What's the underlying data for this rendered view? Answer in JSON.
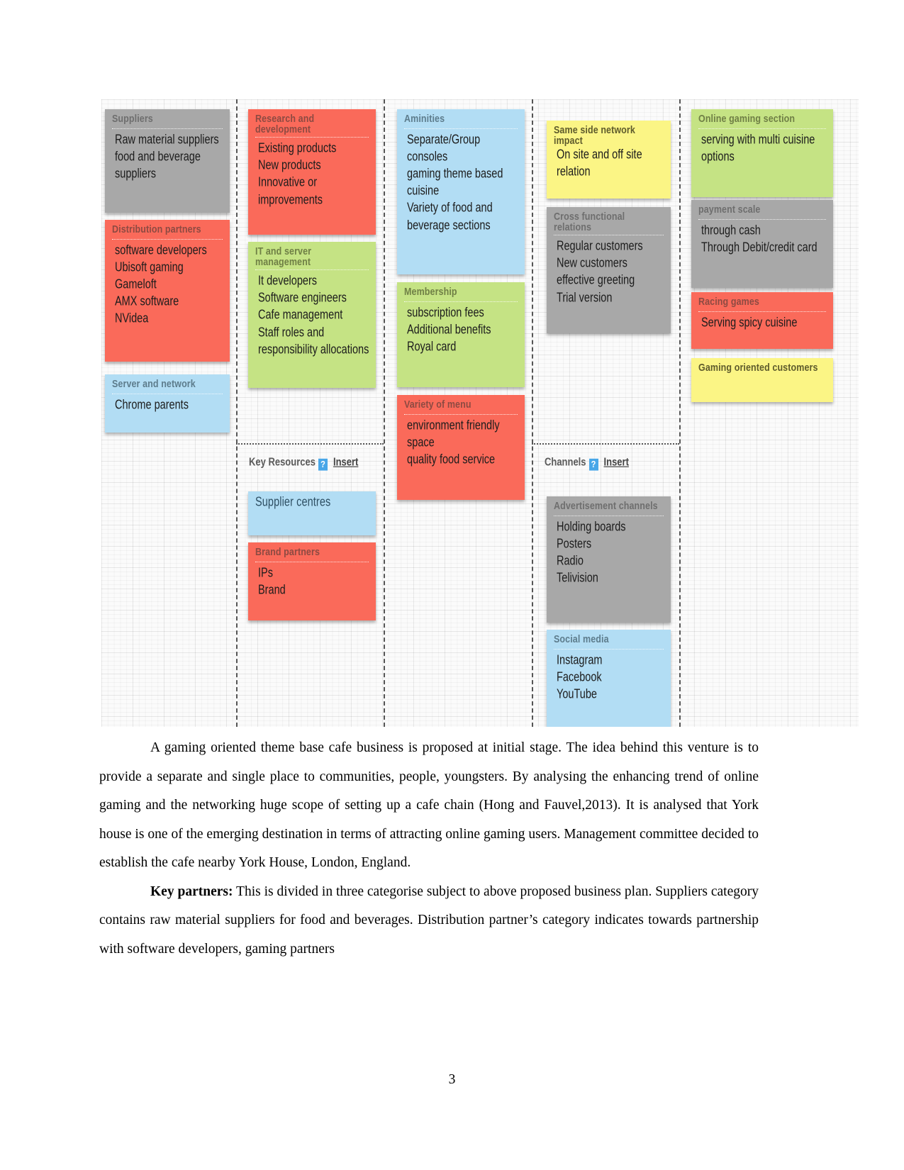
{
  "document": {
    "page_number": "3"
  },
  "canvas": {
    "section_headers": [
      {
        "label": "Key Resources",
        "help": "?",
        "insert": "Insert"
      },
      {
        "label": "Channels",
        "help": "?",
        "insert": "Insert"
      }
    ],
    "columns": [
      {
        "name": "key-partners",
        "cards": [
          {
            "title": "Suppliers",
            "color": "grey",
            "items": [
              "Raw material suppliers",
              "food and beverage",
              "suppliers"
            ]
          },
          {
            "title": "Distribution partners",
            "color": "red",
            "items": [
              "software developers",
              "Ubisoft gaming",
              "Gameloft",
              "AMX software",
              "NVidea"
            ]
          },
          {
            "title": "Server and network",
            "color": "blue",
            "items": [
              "Chrome parents"
            ]
          }
        ]
      },
      {
        "name": "key-activities",
        "cards": [
          {
            "title": "Research and development",
            "color": "red",
            "items": [
              "Existing products",
              "New products",
              "Innovative or",
              "improvements"
            ]
          },
          {
            "title": "IT and server management",
            "color": "green",
            "items": [
              "It developers",
              "Software engineers",
              "Cafe management",
              "Staff roles and",
              "responsibility allocations"
            ]
          },
          {
            "title": "Supplier centres",
            "color": "blue",
            "items": []
          },
          {
            "title": "Brand partners",
            "color": "red",
            "items": [
              "IPs",
              "Brand"
            ]
          }
        ]
      },
      {
        "name": "value-propositions",
        "cards": [
          {
            "title": "Aminities",
            "color": "blue",
            "items": [
              "Separate/Group",
              "consoles",
              "gaming theme based",
              "cuisine",
              "Variety of food and",
              "beverage sections"
            ]
          },
          {
            "title": "Membership",
            "color": "green",
            "items": [
              "subscription fees",
              "Additional benefits",
              "Royal card"
            ]
          },
          {
            "title": "Variety of menu",
            "color": "red",
            "items": [
              "environment friendly",
              "space",
              "quality food service"
            ]
          }
        ]
      },
      {
        "name": "customer-relationships",
        "cards": [
          {
            "title": "Same side network impact",
            "color": "yellow",
            "items": [
              "On site and off site",
              "relation"
            ]
          },
          {
            "title": "Cross functional relations",
            "color": "grey",
            "items": [
              "Regular customers",
              "New customers",
              "effective greeting",
              "Trial version"
            ]
          },
          {
            "title": "Advertisement channels",
            "color": "grey",
            "items": [
              "Holding boards",
              "Posters",
              "Radio",
              "Telivision"
            ]
          },
          {
            "title": "Social media",
            "color": "blue",
            "items": [
              "Instagram",
              "Facebook",
              "YouTube"
            ]
          }
        ]
      },
      {
        "name": "customer-segments",
        "cards": [
          {
            "title": "Online gaming section",
            "color": "green",
            "items": [
              "serving with multi cuisine",
              "options"
            ]
          },
          {
            "title": "payment scale",
            "color": "grey",
            "items": [
              "through cash",
              "Through Debit/credit card"
            ]
          },
          {
            "title": "Racing games",
            "color": "red",
            "items": [
              "Serving spicy cuisine"
            ]
          },
          {
            "title": "Gaming oriented customers",
            "color": "yellow",
            "items": []
          }
        ]
      }
    ]
  },
  "body": {
    "paragraph_1": "A gaming oriented theme base cafe business is proposed at initial stage. The idea behind this venture is to provide a separate and single place to communities, people, youngsters. By analysing the enhancing trend of online gaming and the networking huge scope of setting up a cafe chain (Hong and Fauvel,2013). It is analysed that York house is one of the emerging destination in terms of attracting online gaming users. Management committee decided to establish the cafe nearby York House, London, England.",
    "paragraph_2_lead": "Key partners:",
    "paragraph_2_rest": " This is divided in three categorise subject to above proposed business plan. Suppliers category contains raw material suppliers for food and beverages. Distribution partner’s category indicates towards partnership with software developers, gaming partners"
  },
  "colors": {
    "grey": "#a8a8a8",
    "red": "#fa6a5a",
    "green": "#c5e384",
    "blue": "#b2ddf4",
    "yellow": "#fbf585",
    "help_badge": "#49a7e8"
  }
}
